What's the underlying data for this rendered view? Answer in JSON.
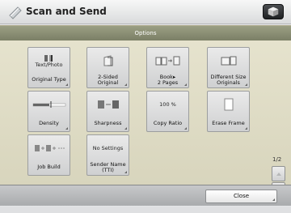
{
  "header": {
    "title": "Scan and Send"
  },
  "options_bar": {
    "title": "Options"
  },
  "tiles": {
    "original_type": {
      "top": "Text/Photo",
      "label": [
        "Original Type"
      ]
    },
    "two_sided": {
      "label": [
        "2-Sided",
        "Original"
      ]
    },
    "book_2pages": {
      "top": [
        "Book▸",
        "2 Pages"
      ]
    },
    "different_size": {
      "top": [
        "Different Size",
        "Originals"
      ]
    },
    "density": {
      "label": [
        "Density"
      ]
    },
    "sharpness": {
      "label": [
        "Sharpness"
      ]
    },
    "copy_ratio": {
      "top": "100 %",
      "label": [
        "Copy Ratio"
      ]
    },
    "erase_frame": {
      "label": [
        "Erase Frame"
      ]
    },
    "job_build": {
      "label": [
        "Job Build"
      ]
    },
    "sender_name": {
      "top": "No Settings",
      "label": [
        "Sender Name",
        "(TTI)"
      ]
    }
  },
  "pagination": {
    "indicator": "1/2"
  },
  "bottom_bar": {
    "close_label": "Close"
  }
}
